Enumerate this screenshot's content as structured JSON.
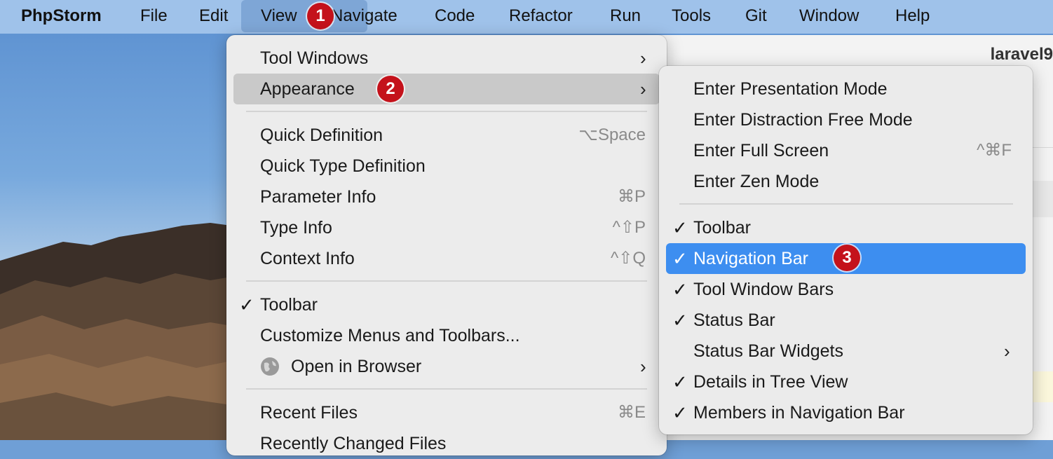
{
  "menubar": {
    "items": [
      "PhpStorm",
      "File",
      "Edit",
      "View",
      "Navigate",
      "Code",
      "Refactor",
      "Run",
      "Tools",
      "Git",
      "Window",
      "Help"
    ],
    "active": "View"
  },
  "ide": {
    "title": "laravel9"
  },
  "badges": [
    "1",
    "2",
    "3"
  ],
  "view_menu": {
    "items": [
      {
        "label": "Tool Windows",
        "submenu": true
      },
      {
        "label": "Appearance",
        "submenu": true,
        "highlighted": true
      },
      {
        "label": "Quick Definition",
        "shortcut": "⌥Space"
      },
      {
        "label": "Quick Type Definition"
      },
      {
        "label": "Parameter Info",
        "shortcut": "⌘P"
      },
      {
        "label": "Type Info",
        "shortcut": "^⇧P"
      },
      {
        "label": "Context Info",
        "shortcut": "^⇧Q"
      },
      {
        "label": "Toolbar",
        "checked": true
      },
      {
        "label": "Customize Menus and Toolbars..."
      },
      {
        "label": "Open in Browser",
        "submenu": true,
        "icon": "globe-icon"
      },
      {
        "label": "Recent Files",
        "shortcut": "⌘E"
      },
      {
        "label": "Recently Changed Files"
      }
    ]
  },
  "appearance_menu": {
    "items": [
      {
        "label": "Enter Presentation Mode"
      },
      {
        "label": "Enter Distraction Free Mode"
      },
      {
        "label": "Enter Full Screen",
        "shortcut": "^⌘F"
      },
      {
        "label": "Enter Zen Mode"
      },
      {
        "label": "Toolbar",
        "checked": true
      },
      {
        "label": "Navigation Bar",
        "checked": true,
        "highlighted": true
      },
      {
        "label": "Tool Window Bars",
        "checked": true
      },
      {
        "label": "Status Bar",
        "checked": true
      },
      {
        "label": "Status Bar Widgets",
        "submenu": true
      },
      {
        "label": "Details in Tree View",
        "checked": true
      },
      {
        "label": "Members in Navigation Bar",
        "checked": true
      }
    ]
  },
  "glyphs": {
    "check": "✓",
    "arrow": "›"
  },
  "colors": {
    "highlight_blue": "#3d8ef0",
    "badge_red": "#c4121b"
  }
}
